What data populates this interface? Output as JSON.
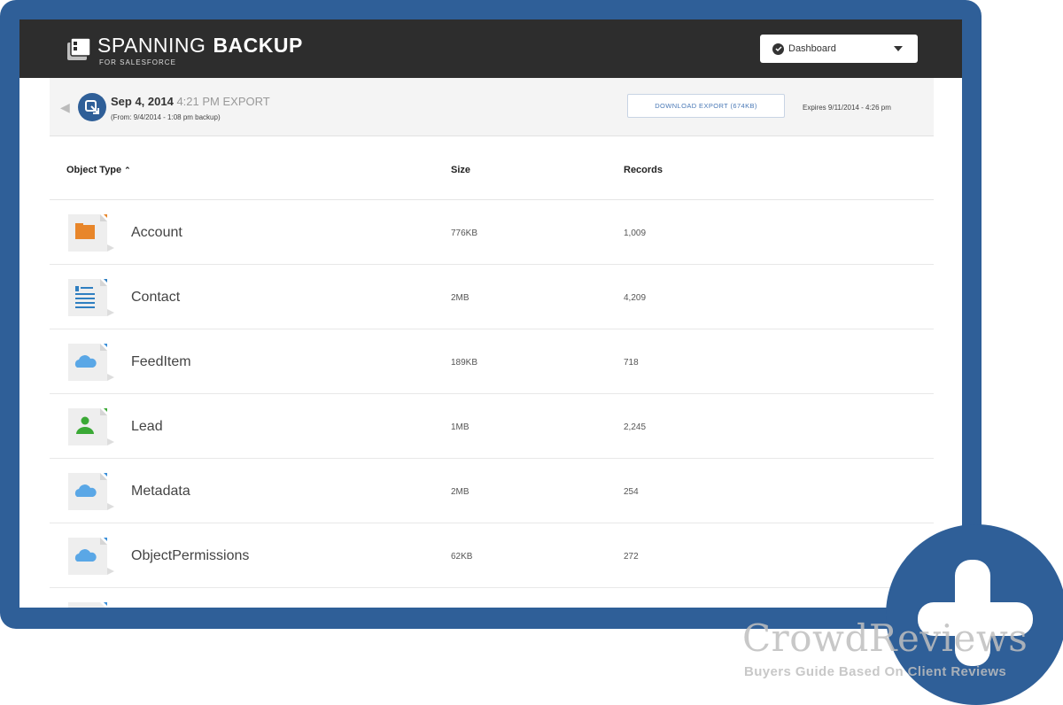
{
  "header": {
    "brand_main": "SPANNING",
    "brand_bold": "BACKUP",
    "brand_sub": "FOR SALESFORCE",
    "dropdown_label": "Dashboard"
  },
  "export": {
    "date": "Sep 4, 2014",
    "time_label": "4:21 PM EXPORT",
    "from": "(From: 9/4/2014 - 1:08 pm backup)",
    "download_label": "DOWNLOAD EXPORT (674KB)",
    "expires": "Expires 9/11/2014 - 4:26 pm"
  },
  "table": {
    "columns": [
      "Object Type",
      "Size",
      "Records"
    ],
    "rows": [
      {
        "type": "Account",
        "size": "776KB",
        "records": "1,009",
        "icon": "folder-icon",
        "accent": "#e8862a"
      },
      {
        "type": "Contact",
        "size": "2MB",
        "records": "4,209",
        "icon": "contact-card-icon",
        "accent": "#2f7fc1"
      },
      {
        "type": "FeedItem",
        "size": "189KB",
        "records": "718",
        "icon": "cloud-icon",
        "accent": "#3a8fd9"
      },
      {
        "type": "Lead",
        "size": "1MB",
        "records": "2,245",
        "icon": "person-icon",
        "accent": "#3aa935"
      },
      {
        "type": "Metadata",
        "size": "2MB",
        "records": "254",
        "icon": "cloud-icon",
        "accent": "#3a8fd9"
      },
      {
        "type": "ObjectPermissions",
        "size": "62KB",
        "records": "272",
        "icon": "cloud-icon",
        "accent": "#3a8fd9"
      }
    ]
  },
  "watermark": {
    "title": "CrowdReviews",
    "subtitle": "Buyers Guide Based On Client Reviews"
  },
  "colors": {
    "frame": "#2f5f98",
    "header": "#2d2d2d"
  }
}
